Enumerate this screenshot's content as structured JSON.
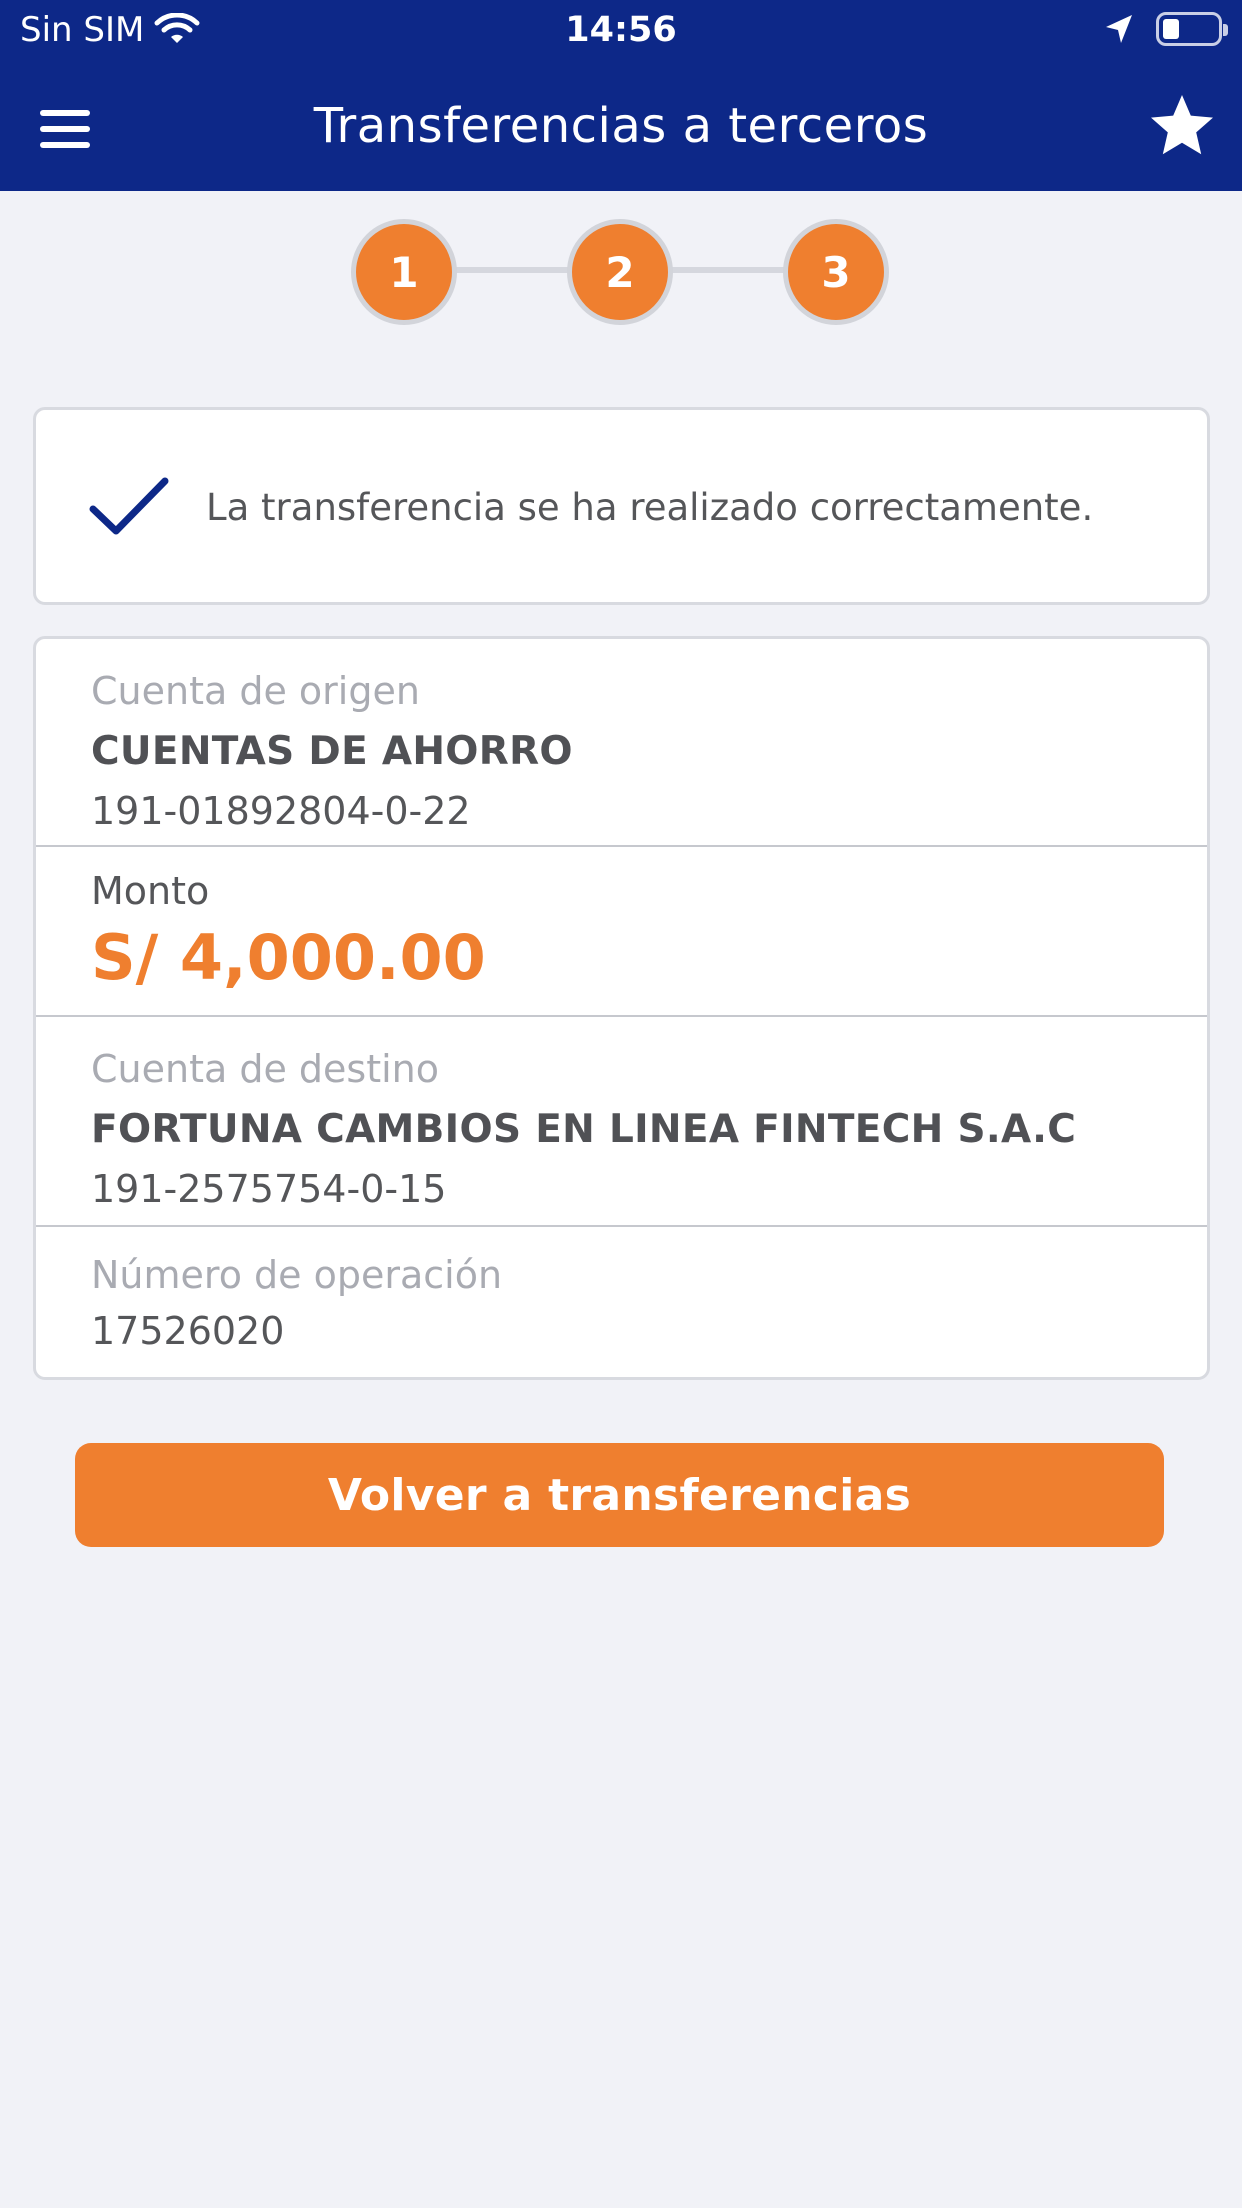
{
  "status_bar": {
    "carrier": "Sin SIM",
    "time": "14:56"
  },
  "header": {
    "title": "Transferencias a terceros",
    "menu_icon": "hamburger-menu-icon",
    "favorite_icon": "star-icon"
  },
  "stepper": {
    "steps": [
      "1",
      "2",
      "3"
    ],
    "current": 3
  },
  "success": {
    "icon": "check-icon",
    "message": "La transferencia se ha realizado correctamente."
  },
  "details": {
    "origin": {
      "label": "Cuenta de origen",
      "name": "CUENTAS DE AHORRO",
      "number": "191-01892804-0-22"
    },
    "amount": {
      "label": "Monto",
      "value": "S/ 4,000.00"
    },
    "destination": {
      "label": "Cuenta de destino",
      "name": "FORTUNA CAMBIOS EN LINEA FINTECH S.A.C",
      "number": "191-2575754-0-15"
    },
    "operation": {
      "label": "Número de operación",
      "value": "17526020"
    }
  },
  "actions": {
    "back_label": "Volver a transferencias"
  },
  "colors": {
    "header_bg": "#0d2888",
    "accent": "#ef7f2f",
    "background": "#f1f2f7"
  }
}
